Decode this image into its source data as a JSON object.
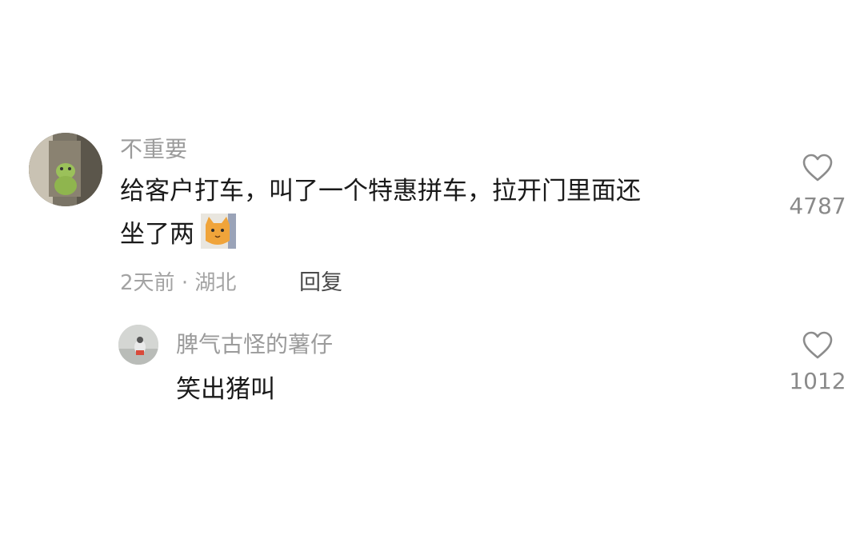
{
  "comment": {
    "username": "不重要",
    "text_line1": "给客户打车，叫了一个特惠拼车，拉开门里面还",
    "text_line2": "坐了两",
    "emoji": "cat-face-emoji",
    "time": "2天前",
    "dot": "·",
    "location": "湖北",
    "reply_label": "回复",
    "likes": "4787"
  },
  "reply": {
    "username": "脾气古怪的薯仔",
    "text": "笑出猪叫",
    "likes": "1012"
  },
  "colors": {
    "username": "#9b9b9b",
    "text": "#1a1a1a",
    "meta": "#a3a3a3",
    "like_outline": "#8c8c8c"
  }
}
